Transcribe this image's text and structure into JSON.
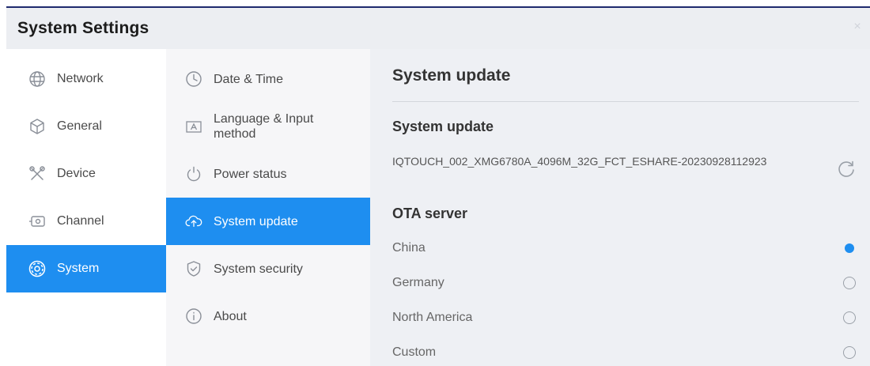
{
  "window": {
    "title": "System Settings",
    "close_glyph": "×"
  },
  "nav": {
    "items": [
      {
        "label": "Network",
        "icon": "globe-icon"
      },
      {
        "label": "General",
        "icon": "cube-icon"
      },
      {
        "label": "Device",
        "icon": "tools-icon"
      },
      {
        "label": "Channel",
        "icon": "input-port-icon"
      },
      {
        "label": "System",
        "icon": "gear-icon",
        "active": true
      }
    ]
  },
  "submenu": {
    "items": [
      {
        "label": "Date & Time",
        "icon": "clock-icon"
      },
      {
        "label": "Language & Input method",
        "icon": "keyboard-icon"
      },
      {
        "label": "Power status",
        "icon": "power-icon"
      },
      {
        "label": "System update",
        "icon": "cloud-upload-icon",
        "active": true
      },
      {
        "label": "System security",
        "icon": "shield-icon"
      },
      {
        "label": "About",
        "icon": "info-icon"
      }
    ]
  },
  "panel": {
    "title": "System update",
    "update_section": {
      "heading": "System update",
      "version": "IQTOUCH_002_XMG6780A_4096M_32G_FCT_ESHARE-20230928112923"
    },
    "ota_section": {
      "heading": "OTA server",
      "options": [
        {
          "label": "China",
          "selected": true
        },
        {
          "label": "Germany",
          "selected": false
        },
        {
          "label": "North America",
          "selected": false
        },
        {
          "label": "Custom",
          "selected": false
        }
      ]
    }
  },
  "colors": {
    "accent": "#1e8ef0",
    "title_bar": "#eceef2",
    "window_border": "#1f2a6e"
  }
}
